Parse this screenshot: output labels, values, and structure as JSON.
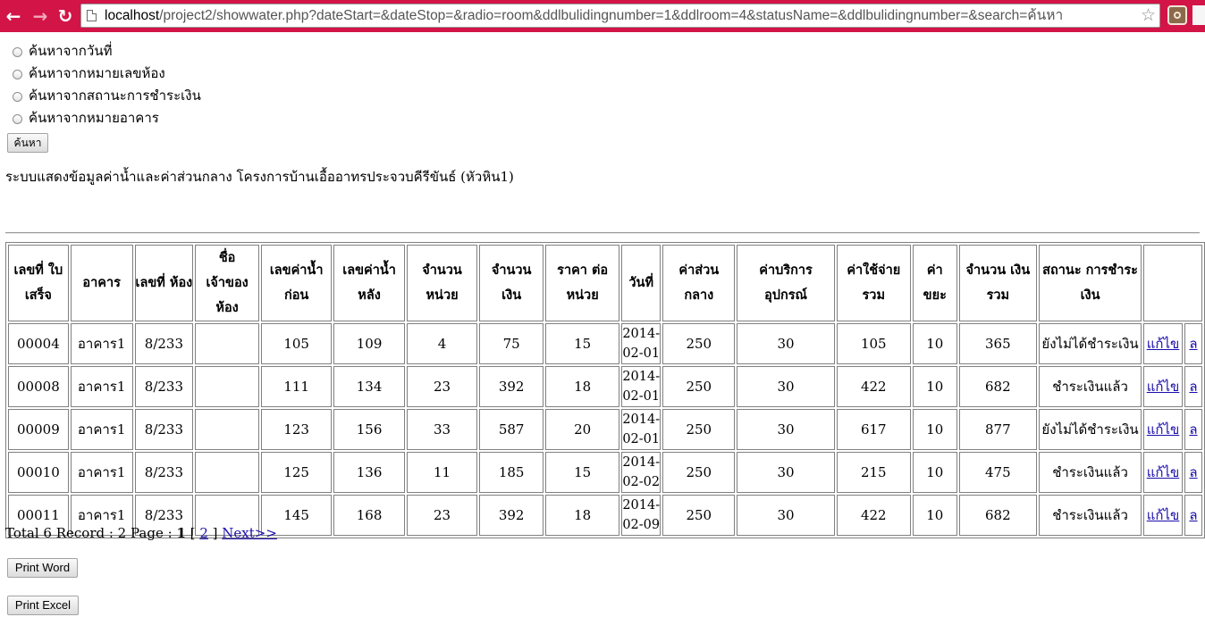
{
  "browser": {
    "url_host": "localhost",
    "url_path": "/project2/showwater.php?dateStart=&dateStop=&radio=room&ddlbulidingnumber=1&ddlroom=4&statusName=&ddlbulidingnumber=&search=ค้นหา",
    "back_icon": "←",
    "forward_icon": "→",
    "reload_icon": "↻",
    "star_icon": "☆"
  },
  "search": {
    "options": [
      "ค้นหาจากวันที่",
      "ค้นหาจากหมายเลขห้อง",
      "ค้นหาจากสถานะการชำระเงิน",
      "ค้นหาจากหมายอาคาร"
    ],
    "button_label": "ค้นหา"
  },
  "page_title": "ระบบแสดงข้อมูลค่าน้ำและค่าส่วนกลาง โครงการบ้านเอื้ออาทรประจวบคีรีขันธ์ (หัวหิน1)",
  "table": {
    "headers": [
      "เลขที่ ใบเสร็จ",
      "อาคาร",
      "เลขที่ ห้อง",
      "ชื่อ เจ้าของห้อง",
      "เลขค่าน้ำ ก่อน",
      "เลขค่าน้ำ หลัง",
      "จำนวน หน่วย",
      "จำนวน เงิน",
      "ราคา ต่อหน่วย",
      "วันที่",
      "ค่าส่วน กลาง",
      "ค่าบริการ อุปกรณ์",
      "ค่าใช้จ่าย รวม",
      "ค่า ขยะ",
      "จำนวน เงินรวม",
      "สถานะ การชำระเงิน",
      ""
    ],
    "rows": [
      {
        "receipt": "00004",
        "building": "อาคาร1",
        "room": "8/233",
        "owner": "",
        "before": "105",
        "after": "109",
        "units": "4",
        "amount": "75",
        "unit_price": "15",
        "date_y": "2014-",
        "date_md": "02-01",
        "common_fee": "250",
        "equipment_fee": "30",
        "total_expense": "105",
        "garbage_fee": "10",
        "grand_total": "365",
        "status": "ยังไม่ได้ชำระเงิน",
        "edit": "แก้ไข",
        "extra": "ล"
      },
      {
        "receipt": "00008",
        "building": "อาคาร1",
        "room": "8/233",
        "owner": "",
        "before": "111",
        "after": "134",
        "units": "23",
        "amount": "392",
        "unit_price": "18",
        "date_y": "2014-",
        "date_md": "02-01",
        "common_fee": "250",
        "equipment_fee": "30",
        "total_expense": "422",
        "garbage_fee": "10",
        "grand_total": "682",
        "status": "ชำระเงินแล้ว",
        "edit": "แก้ไข",
        "extra": "ล"
      },
      {
        "receipt": "00009",
        "building": "อาคาร1",
        "room": "8/233",
        "owner": "",
        "before": "123",
        "after": "156",
        "units": "33",
        "amount": "587",
        "unit_price": "20",
        "date_y": "2014-",
        "date_md": "02-01",
        "common_fee": "250",
        "equipment_fee": "30",
        "total_expense": "617",
        "garbage_fee": "10",
        "grand_total": "877",
        "status": "ยังไม่ได้ชำระเงิน",
        "edit": "แก้ไข",
        "extra": "ล"
      },
      {
        "receipt": "00010",
        "building": "อาคาร1",
        "room": "8/233",
        "owner": "",
        "before": "125",
        "after": "136",
        "units": "11",
        "amount": "185",
        "unit_price": "15",
        "date_y": "2014-",
        "date_md": "02-02",
        "common_fee": "250",
        "equipment_fee": "30",
        "total_expense": "215",
        "garbage_fee": "10",
        "grand_total": "475",
        "status": "ชำระเงินแล้ว",
        "edit": "แก้ไข",
        "extra": "ล"
      },
      {
        "receipt": "00011",
        "building": "อาคาร1",
        "room": "8/233",
        "owner": "",
        "before": "145",
        "after": "168",
        "units": "23",
        "amount": "392",
        "unit_price": "18",
        "date_y": "2014-",
        "date_md": "02-09",
        "common_fee": "250",
        "equipment_fee": "30",
        "total_expense": "422",
        "garbage_fee": "10",
        "grand_total": "682",
        "status": "ชำระเงินแล้ว",
        "edit": "แก้ไข",
        "extra": "ล"
      }
    ]
  },
  "pager": {
    "prefix": "Total 6 Record : 2 Page :",
    "current": "1",
    "open_bracket": "[",
    "page2": "2",
    "close_bracket": "]",
    "next": "Next>>"
  },
  "actions": {
    "print_word": "Print Word",
    "print_excel": "Print Excel"
  }
}
